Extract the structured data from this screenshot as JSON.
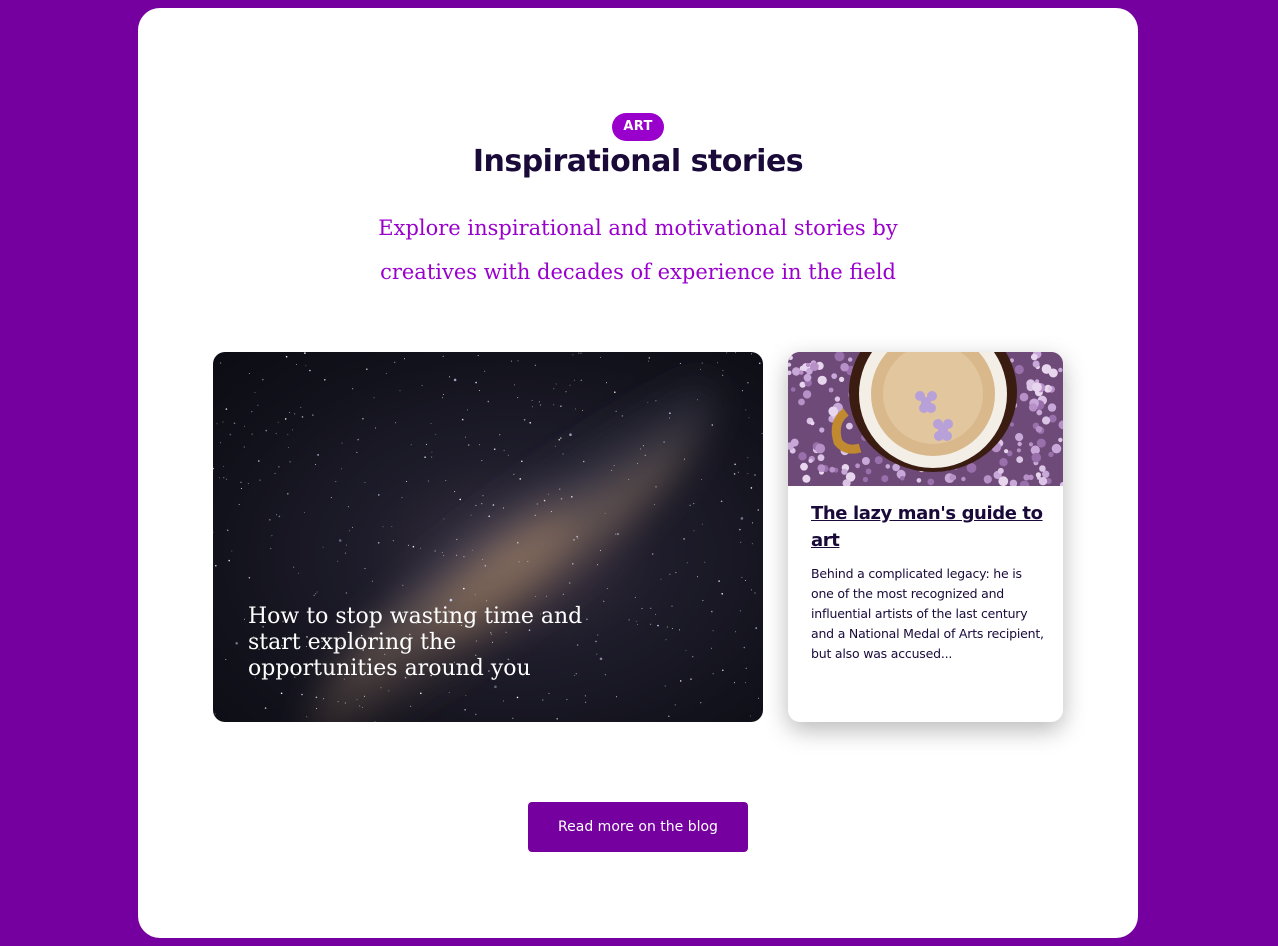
{
  "colors": {
    "page_background": "#76009f",
    "accent": "#9900cc",
    "heading": "#1a0a3a",
    "button": "#76009f"
  },
  "header": {
    "tag": "ART",
    "title": "Inspirational stories",
    "subtitle": "Explore inspirational and motivational stories by creatives with decades of experience in the field"
  },
  "featured_post": {
    "title": "How to stop wasting time and start exploring the opportunities around you",
    "image": "milky-way-night-sky"
  },
  "side_post": {
    "image": "coffee-cup-with-lilac-flowers",
    "title": "The lazy man's guide to art",
    "excerpt": "Behind a complicated legacy: he is one of the most recognized and influential artists of the last century and a National Medal of Arts recipient, but also was accused..."
  },
  "cta": {
    "label": "Read more on the blog"
  }
}
